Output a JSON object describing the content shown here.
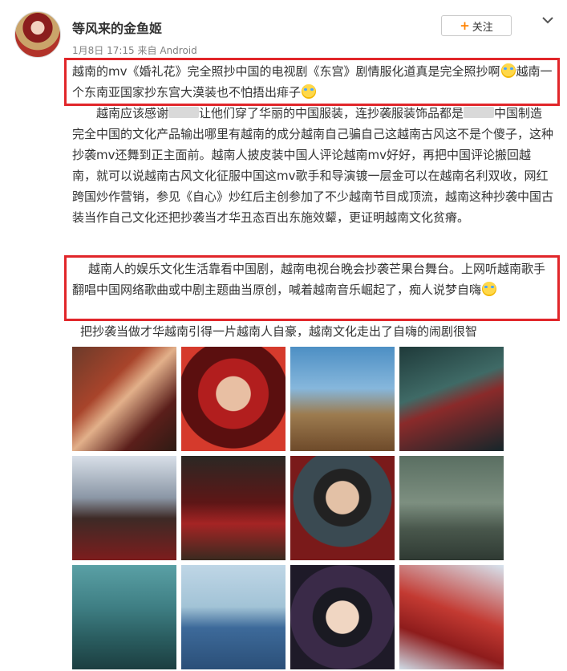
{
  "post": {
    "username": "等风来的金鱼姬",
    "date": "1月8日 17:15",
    "source_prefix": "来自",
    "source": "Android",
    "follow_label": "关注",
    "follow_plus": "+"
  },
  "text": {
    "p1a": "越南的mv《婚礼花》完全照抄中国的电视剧《东宫》剧情服化道真是完全照抄啊",
    "p1b": "越南一个东南亚国家抄东宫大漠装也不怕捂出痱子",
    "p2a": "越南应该感谢",
    "p2b": "让他们穿了华丽的中国服装，连抄袭服装饰品都是",
    "p2c": "中国制造完全中国的文化产品输出哪里有越南的成分越南自己骗自己这越南古风这不是个傻子，这种抄袭mv还舞到正主面前。越南人披皮装中国人评论越南mv好好，再把中国评论搬回越南，就可以说越南古风文化征服中国这mv歌手和导演镀一层金可以在越南名利双收，网红跨国炒作营销，参见《自心》炒红后主创参加了不少越南节目成顶流，越南这种抄袭中国古装当作自己文化还把抄袭当才华丑态百出东施效颦，更证明越南文化贫瘠。",
    "p3a": "越南人的娱乐文化生活靠看中国剧，越南电视台晚会抄袭芒果台舞台。上网听越南歌手翻唱中国网络歌曲或中剧主题曲当原创，喊着越南音乐崛起了，痴人说梦自嗨",
    "p4": "把抄袭当做才华越南引得一片越南人自豪，越南文化走出了自嗨的闹剧很智"
  },
  "icons": {
    "emoji": "crying-laughing-emoji",
    "chevron": "chevron-down-icon",
    "accent": "#ff8200",
    "highlight": "#e1262a"
  },
  "photos": [
    "costume-bride-with-man",
    "red-headdress-woman",
    "couple-in-desert",
    "dark-scene-couple",
    "snowy-figures",
    "couple-sitting-red",
    "man-in-red-armor",
    "outdoor-legs-grass",
    "teal-forest-figure",
    "woman-in-blue",
    "woman-with-ornament",
    "woman-red-cape"
  ]
}
